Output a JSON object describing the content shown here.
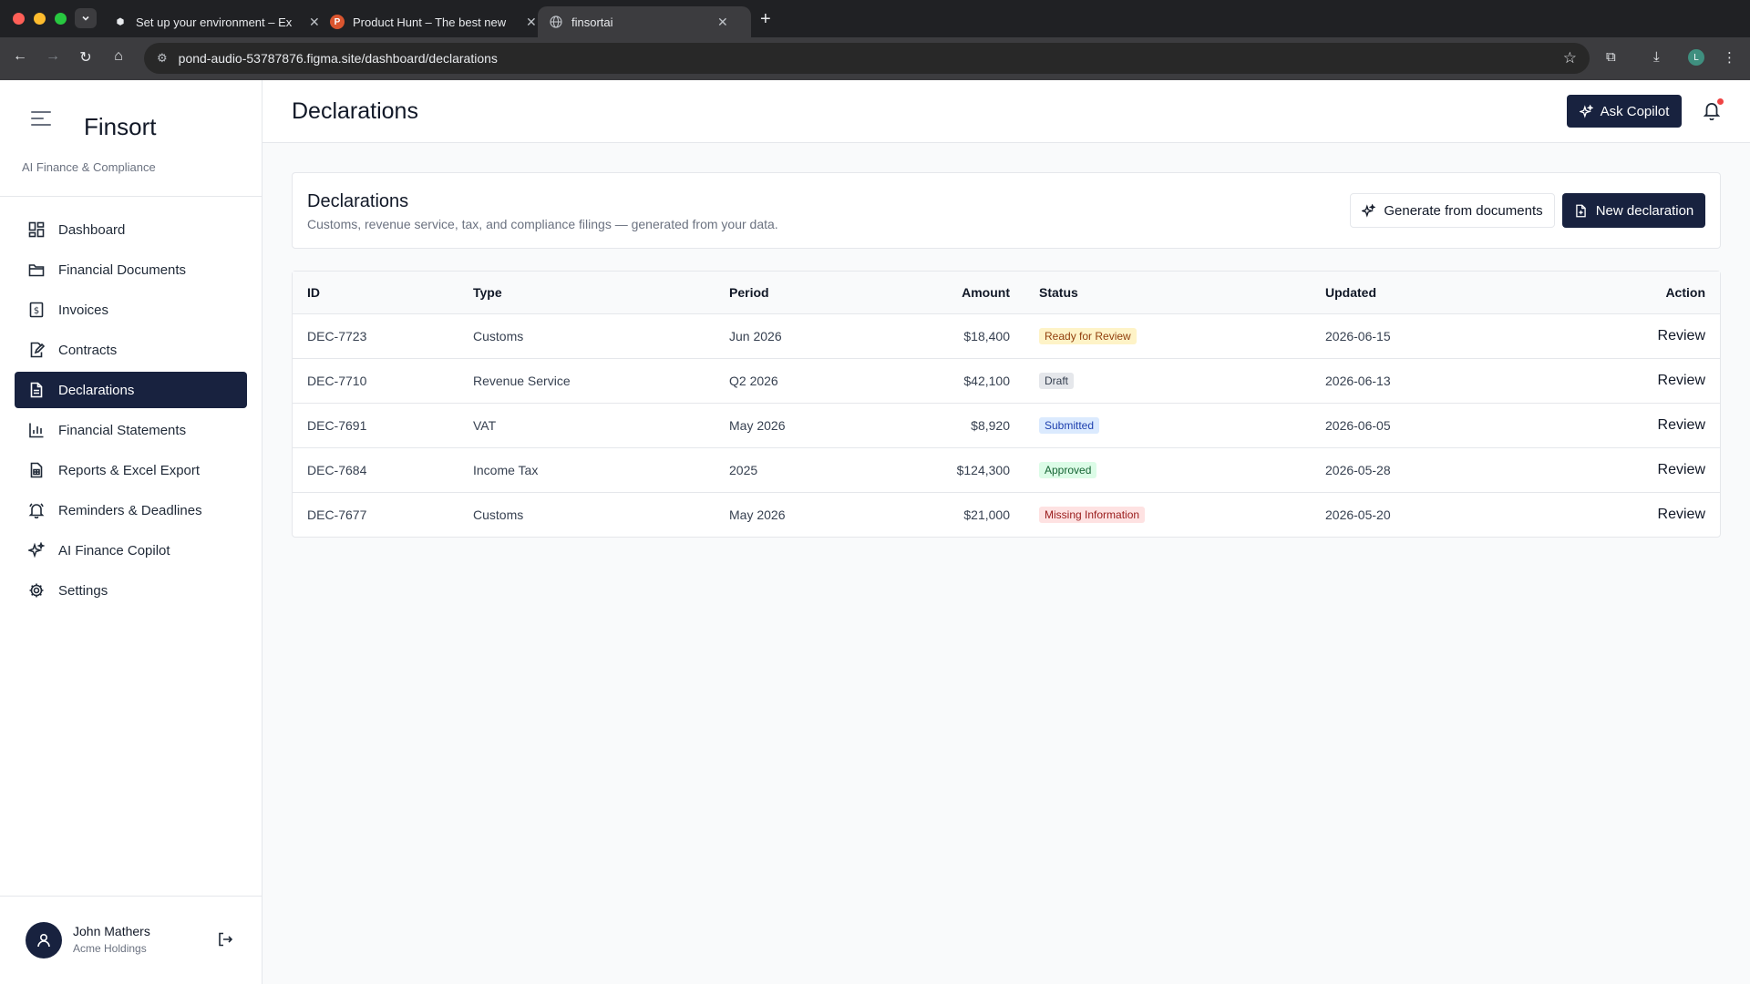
{
  "browser": {
    "tabs": [
      {
        "title": "Set up your environment – Ex",
        "favicon": "cursor"
      },
      {
        "title": "Product Hunt – The best new",
        "favicon": "P"
      },
      {
        "title": "finsortai",
        "favicon": "globe"
      }
    ],
    "url": "pond-audio-53787876.figma.site/dashboard/declarations",
    "profile_initial": "L"
  },
  "sidebar": {
    "brand": "Finsort",
    "tagline": "AI Finance & Compliance",
    "items": [
      {
        "label": "Dashboard",
        "icon": "grid-icon"
      },
      {
        "label": "Financial Documents",
        "icon": "folder-icon"
      },
      {
        "label": "Invoices",
        "icon": "dollar-receipt-icon"
      },
      {
        "label": "Contracts",
        "icon": "contract-edit-icon"
      },
      {
        "label": "Declarations",
        "icon": "document-icon"
      },
      {
        "label": "Financial Statements",
        "icon": "bar-chart-icon"
      },
      {
        "label": "Reports & Excel Export",
        "icon": "spreadsheet-icon"
      },
      {
        "label": "Reminders & Deadlines",
        "icon": "bell-icon"
      },
      {
        "label": "AI Finance Copilot",
        "icon": "sparkles-icon"
      },
      {
        "label": "Settings",
        "icon": "gear-icon"
      }
    ],
    "user": {
      "name": "John Mathers",
      "org": "Acme Holdings"
    }
  },
  "header": {
    "title": "Declarations",
    "copilot_label": "Ask Copilot"
  },
  "card": {
    "title": "Declarations",
    "subtitle": "Customs, revenue service, tax, and compliance filings — generated from your data.",
    "generate_label": "Generate from documents",
    "new_label": "New declaration"
  },
  "table": {
    "headers": {
      "id": "ID",
      "type": "Type",
      "period": "Period",
      "amount": "Amount",
      "status": "Status",
      "updated": "Updated",
      "action": "Action"
    },
    "rows": [
      {
        "id": "DEC-7723",
        "type": "Customs",
        "period": "Jun 2026",
        "amount": "$18,400",
        "status": "Ready for Review",
        "status_bg": "#fef3c7",
        "status_fg": "#92400e",
        "updated": "2026-06-15",
        "action": "Review"
      },
      {
        "id": "DEC-7710",
        "type": "Revenue Service",
        "period": "Q2 2026",
        "amount": "$42,100",
        "status": "Draft",
        "status_bg": "#e5e7eb",
        "status_fg": "#374151",
        "updated": "2026-06-13",
        "action": "Review"
      },
      {
        "id": "DEC-7691",
        "type": "VAT",
        "period": "May 2026",
        "amount": "$8,920",
        "status": "Submitted",
        "status_bg": "#dbeafe",
        "status_fg": "#1e40af",
        "updated": "2026-06-05",
        "action": "Review"
      },
      {
        "id": "DEC-7684",
        "type": "Income Tax",
        "period": "2025",
        "amount": "$124,300",
        "status": "Approved",
        "status_bg": "#dcfce7",
        "status_fg": "#166534",
        "updated": "2026-05-28",
        "action": "Review"
      },
      {
        "id": "DEC-7677",
        "type": "Customs",
        "period": "May 2026",
        "amount": "$21,000",
        "status": "Missing Information",
        "status_bg": "#fee2e2",
        "status_fg": "#991b1b",
        "updated": "2026-05-20",
        "action": "Review"
      }
    ]
  },
  "colors": {
    "brand_dark": "#18223f",
    "notification_dot": "#ef4444"
  }
}
